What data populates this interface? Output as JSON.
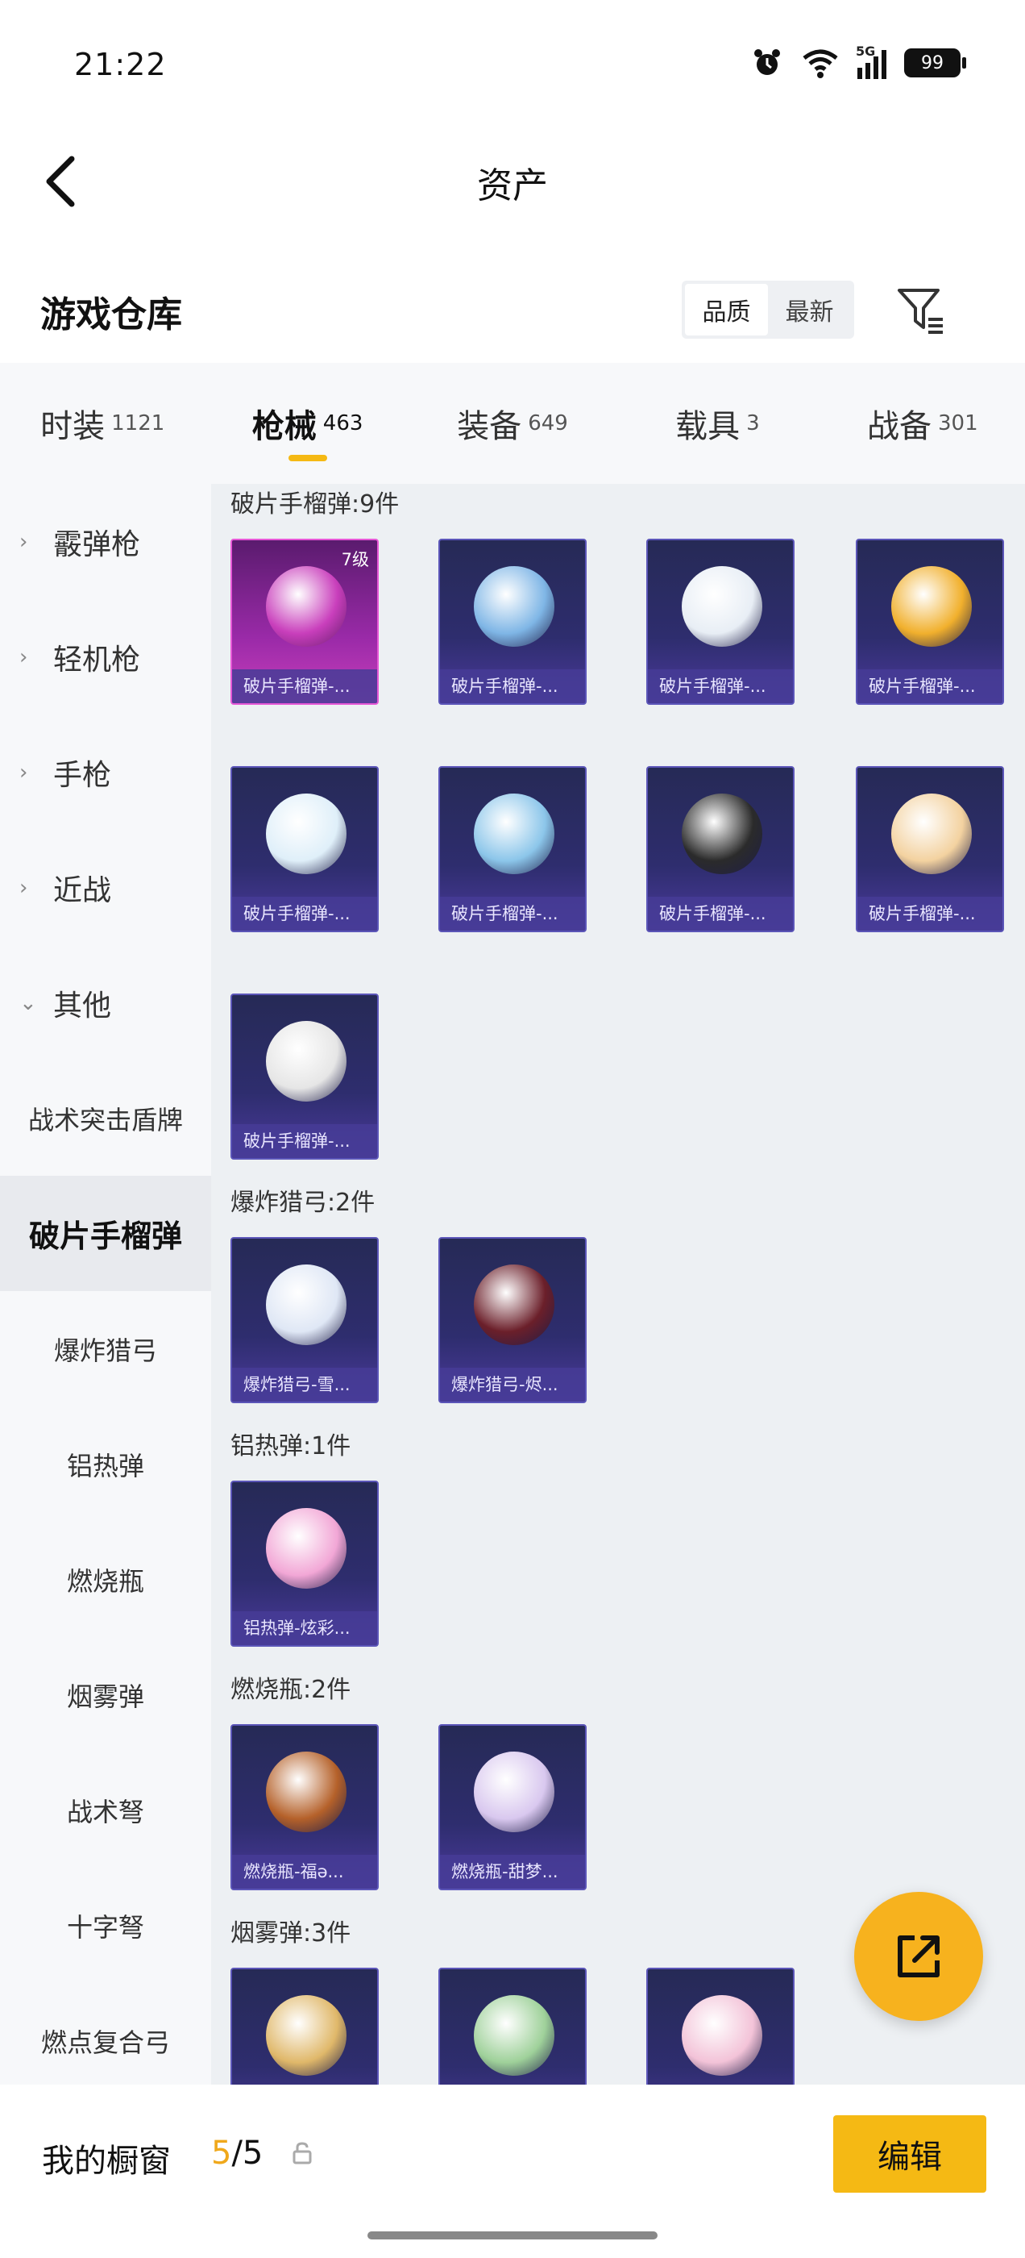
{
  "status_bar": {
    "time": "21:22",
    "network": "5G",
    "battery": "99"
  },
  "header": {
    "title": "资产"
  },
  "warehouse": {
    "title": "游戏仓库",
    "sort_options": [
      "品质",
      "最新"
    ]
  },
  "tabs": [
    {
      "label": "时装",
      "count": "1121"
    },
    {
      "label": "枪械",
      "count": "463",
      "active": true
    },
    {
      "label": "装备",
      "count": "649"
    },
    {
      "label": "载具",
      "count": "3"
    },
    {
      "label": "战备",
      "count": "301"
    }
  ],
  "sidebar": {
    "categories": [
      {
        "label": "霰弹枪",
        "expanded": false
      },
      {
        "label": "轻机枪",
        "expanded": false
      },
      {
        "label": "手枪",
        "expanded": false
      },
      {
        "label": "近战",
        "expanded": false
      },
      {
        "label": "其他",
        "expanded": true
      }
    ],
    "subcategories": [
      "战术突击盾牌",
      "破片手榴弹",
      "爆炸猎弓",
      "铝热弹",
      "燃烧瓶",
      "烟雾弹",
      "战术弩",
      "十字弩",
      "燃点复合弓"
    ],
    "active_subcategory": "破片手榴弹"
  },
  "groups": [
    {
      "title": "破片手榴弹:9件",
      "items": [
        {
          "name": "破片手榴弹-...",
          "tier": "7级",
          "color": "#c93fbc"
        },
        {
          "name": "破片手榴弹-...",
          "color": "#7fb6e6"
        },
        {
          "name": "破片手榴弹-...",
          "color": "#e8eef5"
        },
        {
          "name": "破片手榴弹-...",
          "color": "#f1b02d"
        },
        {
          "name": "破片手榴弹-...",
          "color": "#dfeff9"
        },
        {
          "name": "破片手榴弹-...",
          "color": "#8cc6ea"
        },
        {
          "name": "破片手榴弹-...",
          "color": "#2b2b2b"
        },
        {
          "name": "破片手榴弹-...",
          "color": "#f3d2a0"
        },
        {
          "name": "破片手榴弹-...",
          "color": "#e6e6e6"
        }
      ]
    },
    {
      "title": "爆炸猎弓:2件",
      "items": [
        {
          "name": "爆炸猎弓-雪...",
          "color": "#dfe7f5"
        },
        {
          "name": "爆炸猎弓-烬...",
          "color": "#6b1f2a"
        }
      ]
    },
    {
      "title": "铝热弹:1件",
      "items": [
        {
          "name": "铝热弹-炫彩...",
          "color": "#f2a7d6"
        }
      ]
    },
    {
      "title": "燃烧瓶:2件",
      "items": [
        {
          "name": "燃烧瓶-福ə...",
          "color": "#b5612a"
        },
        {
          "name": "燃烧瓶-甜梦...",
          "color": "#d9c8ef"
        }
      ]
    },
    {
      "title": "烟雾弹:3件",
      "items": [
        {
          "name": "",
          "color": "#e0b86a"
        },
        {
          "name": "",
          "color": "#9fd19a"
        },
        {
          "name": "",
          "color": "#f3c3d8"
        }
      ]
    }
  ],
  "bottom_bar": {
    "label": "我的橱窗",
    "current": "5",
    "total": "/5",
    "edit_label": "编辑"
  }
}
